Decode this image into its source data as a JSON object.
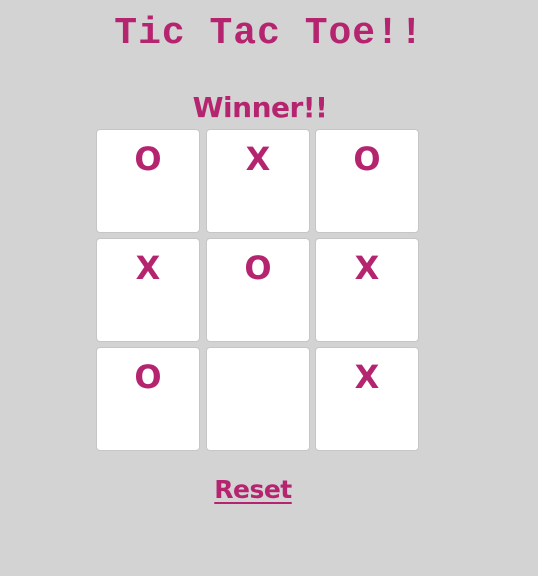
{
  "game": {
    "title": "Tic Tac Toe!!",
    "status": "Winner!!",
    "reset_label": "Reset"
  },
  "board": {
    "cells": [
      "O",
      "X",
      "O",
      "X",
      "O",
      "X",
      "O",
      "",
      "X"
    ]
  },
  "colors": {
    "accent": "#b5256f",
    "background": "#d3d3d3",
    "cell_background": "#ffffff"
  }
}
